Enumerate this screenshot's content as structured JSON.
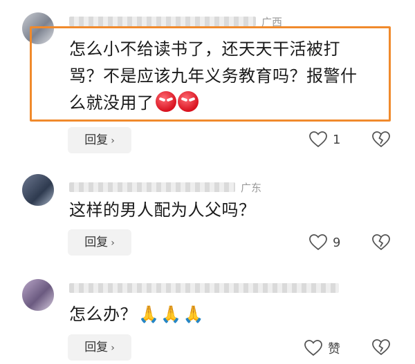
{
  "comments": [
    {
      "meta_tail": "广西",
      "text_line1": "怎么小不给读书了，还天天干活被打",
      "text_line2": "骂？不是应该九年义务教育吗？报警什",
      "text_line3": "么就没用了",
      "reply_label": "回复",
      "like_count": "1"
    },
    {
      "meta_tail": "广东",
      "text_line1": "这样的男人配为人父吗？",
      "reply_label": "回复",
      "like_count": "9"
    },
    {
      "meta_tail": "",
      "text_line1": "怎么办？",
      "reply_label": "回复",
      "like_count": "赞"
    }
  ],
  "icons": {
    "heart": "heart-icon",
    "broken_heart": "broken-heart-icon",
    "chevron": "›"
  },
  "colors": {
    "highlight_border": "#f08a2c",
    "reply_bg": "#f2f2f2"
  }
}
